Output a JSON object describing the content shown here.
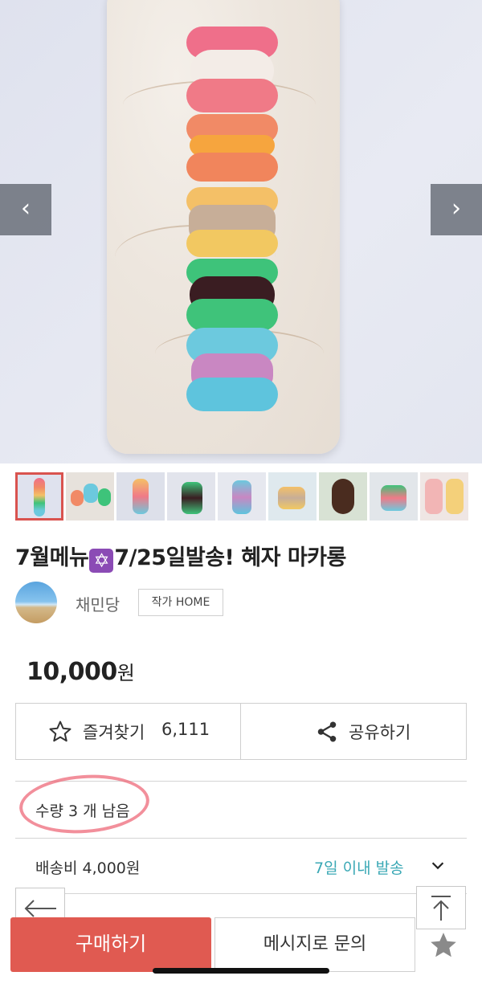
{
  "gallery": {
    "prev_icon": "chevron-left-icon",
    "next_icon": "chevron-right-icon",
    "prev_glyph": "‹",
    "next_glyph": "›",
    "thumbnail_count": 9
  },
  "product": {
    "title_prefix": "7월메뉴",
    "title_emoji": "✡",
    "title_suffix": "7/25일발송! 혜자 마카롱",
    "price_amount": "10,000",
    "price_unit": "원"
  },
  "seller": {
    "name": "채민당",
    "home_button": "작가 HOME"
  },
  "actions": {
    "favorite_label": "즐겨찾기",
    "favorite_count": "6,111",
    "share_label": "공유하기"
  },
  "stock": {
    "text": "수량 3 개 남음"
  },
  "shipping": {
    "fee_label": "배송비 4,000원",
    "dispatch_text": "7일 이내 발송"
  },
  "bottom": {
    "buy_label": "구매하기",
    "message_label": "메시지로 문의"
  },
  "colors": {
    "accent_red": "#e05a51",
    "teal": "#3aa8b5",
    "highlight_circle": "#ed5f70"
  }
}
